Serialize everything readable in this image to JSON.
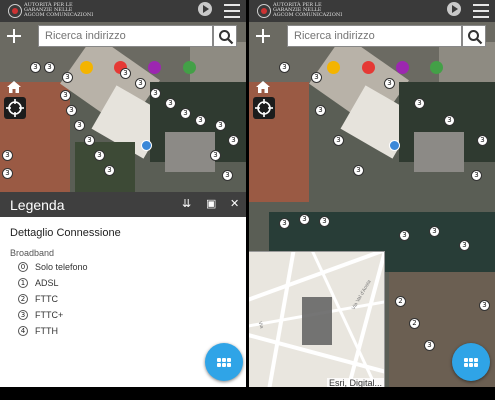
{
  "app": {
    "logo_lines": [
      "AUTORITÀ PER LE",
      "GARANZIE NELLE",
      "AGCOM  COMUNICAZIONI"
    ]
  },
  "search": {
    "placeholder": "Ricerca indirizzo"
  },
  "legend": {
    "title": "Legenda",
    "section_title": "Dettaglio Connessione",
    "subsection": "Broadband",
    "items": [
      {
        "symbol": "0",
        "label": "Solo telefono"
      },
      {
        "symbol": "1",
        "label": "ADSL"
      },
      {
        "symbol": "2",
        "label": "FTTC"
      },
      {
        "symbol": "3",
        "label": "FTTC+"
      },
      {
        "symbol": "4",
        "label": "FTTH"
      }
    ]
  },
  "map": {
    "marker_number": "3",
    "marker_number_alt": "2",
    "tool_colors": [
      "#f4b400",
      "#e53935",
      "#9c27b0",
      "#43a047"
    ],
    "overview_streets": [
      "Via Val d'Aosta",
      "Via"
    ],
    "attribution": "Esri, Digital..."
  },
  "colors": {
    "accent": "#2fa4e7",
    "header": "#3a3a3a",
    "panel_header": "#3f3f3f"
  }
}
